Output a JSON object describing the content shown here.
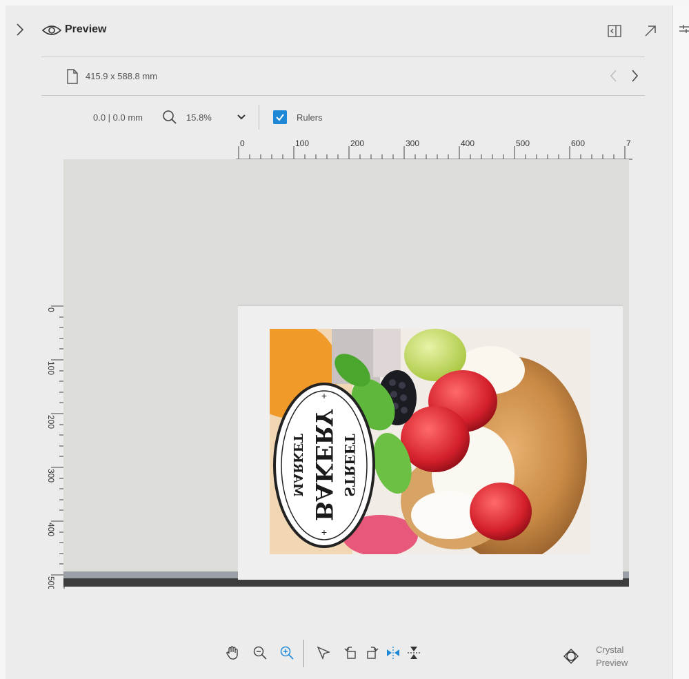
{
  "panel": {
    "title": "Preview"
  },
  "document": {
    "size": "415.9 x 588.8 mm"
  },
  "view": {
    "coordinates": "0.0 | 0.0 mm",
    "zoom": "15.8%",
    "rulers_label": "Rulers",
    "rulers_checked": true
  },
  "rulers": {
    "horizontal_labels": [
      "0",
      "100",
      "200",
      "300",
      "400",
      "500",
      "600",
      "7"
    ],
    "vertical_labels": [
      "0",
      "100",
      "200",
      "300",
      "400",
      "500"
    ]
  },
  "artwork": {
    "badge_line1": "STREET",
    "badge_line2": "BAKERY",
    "badge_line3": "MARKET"
  },
  "bottom_toolbar": {
    "icons": [
      "pan-hand-icon",
      "zoom-out-icon",
      "zoom-in-icon",
      "select-arrow-icon",
      "rotate-left-icon",
      "rotate-right-icon",
      "flip-horizontal-icon",
      "flip-vertical-icon"
    ],
    "crystal_label_line1": "Crystal",
    "crystal_label_line2": "Preview"
  },
  "colors": {
    "accent": "#1e88d6",
    "canvas": "#dcdcd8",
    "page": "#efefef"
  }
}
